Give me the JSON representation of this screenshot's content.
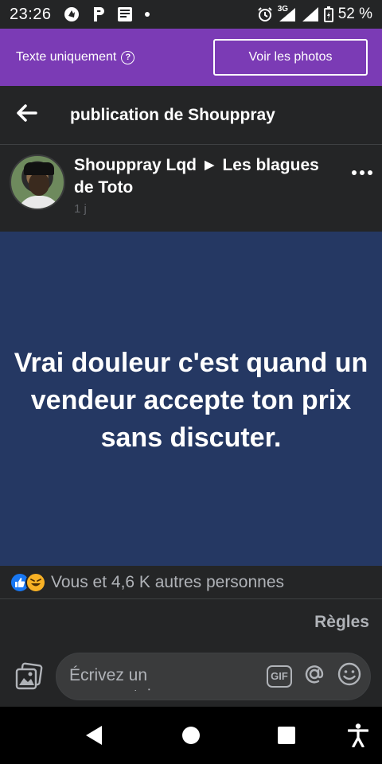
{
  "status_bar": {
    "time": "23:26",
    "network": "3G",
    "battery": "52 %",
    "icons": [
      "notification-icon",
      "parking-icon",
      "news-icon",
      "dot-icon",
      "alarm-icon",
      "signal-icon",
      "battery-icon"
    ]
  },
  "banner": {
    "text_only_label": "Texte uniquement",
    "show_photos_label": "Voir les photos",
    "background": "#7b3bb5"
  },
  "header": {
    "title": "publication de Shouppray"
  },
  "post": {
    "author": "Shouppray Lqd ► Les blagues de Toto",
    "time": "1 j",
    "message": "Vrai douleur c'est quand un vendeur accepte ton prix sans discuter.",
    "background": "#253863"
  },
  "reactions": {
    "icons": [
      "like-icon",
      "haha-icon"
    ],
    "text": "Vous et 4,6 K autres personnes"
  },
  "rules_label": "Règles",
  "composer": {
    "placeholder": "Écrivez un commentaire",
    "gif_label": "GIF"
  }
}
